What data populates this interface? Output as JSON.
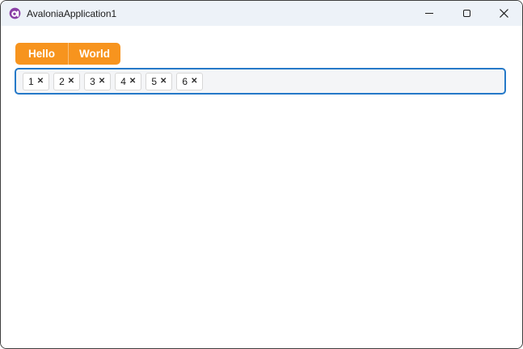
{
  "window": {
    "title": "AvaloniaApplication1",
    "app_icon": "avalonia-logo",
    "controls": [
      {
        "name": "minimize",
        "icon": "minimize-icon"
      },
      {
        "name": "maximize",
        "icon": "maximize-icon"
      },
      {
        "name": "close",
        "icon": "close-icon"
      }
    ]
  },
  "colors": {
    "titlebar_bg": "#EDF2F8",
    "accent_orange": "#F7941E",
    "tab_divider": "rgba(255,255,255,0.40)",
    "focus_border_blue": "#2579C8",
    "tagbox_bg": "#F4F5F7",
    "tag_border": "#D7D7D7",
    "window_border": "#3E3E3E",
    "logo_purple": "#8A3FA6"
  },
  "tabs": {
    "items": [
      {
        "label": "Hello"
      },
      {
        "label": "World"
      }
    ]
  },
  "tagbox": {
    "tags": [
      {
        "value": "1",
        "remove_glyph": "✕"
      },
      {
        "value": "2",
        "remove_glyph": "✕"
      },
      {
        "value": "3",
        "remove_glyph": "✕"
      },
      {
        "value": "4",
        "remove_glyph": "✕"
      },
      {
        "value": "5",
        "remove_glyph": "✕"
      },
      {
        "value": "6",
        "remove_glyph": "✕"
      }
    ]
  }
}
